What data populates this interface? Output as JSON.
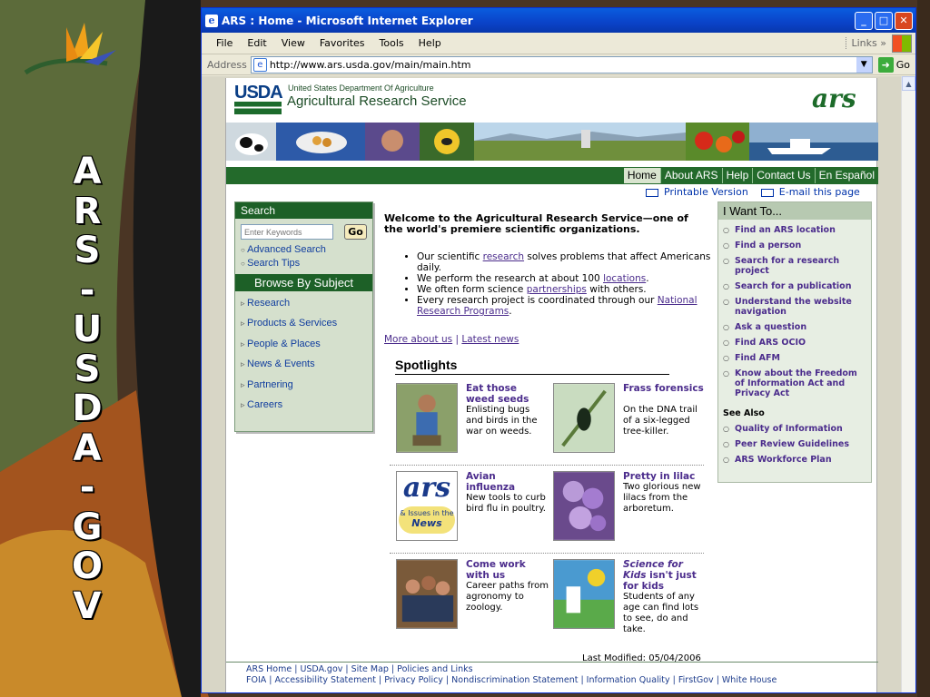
{
  "slide": {
    "vertical_title_chars": [
      "A",
      "R",
      "S",
      "-",
      "U",
      "S",
      "D",
      "A",
      "-",
      "G",
      "O",
      "V"
    ]
  },
  "window": {
    "title": "ARS : Home - Microsoft Internet Explorer",
    "menu": [
      "File",
      "Edit",
      "View",
      "Favorites",
      "Tools",
      "Help"
    ],
    "links_label": "Links",
    "address_label": "Address",
    "url": "http://www.ars.usda.gov/main/main.htm",
    "go_label": "Go"
  },
  "header": {
    "usda": "USDA",
    "dept": "United States Department Of Agriculture",
    "agency": "Agricultural Research Service",
    "ars_logo": "ars"
  },
  "nav": [
    "Home",
    "About ARS",
    "Help",
    "Contact Us",
    "En Español"
  ],
  "util": {
    "printable": "Printable Version",
    "email": "E-mail this page"
  },
  "search": {
    "title": "Search",
    "placeholder": "Enter Keywords",
    "go": "Go",
    "links": [
      "Advanced Search",
      "Search Tips"
    ],
    "browse_title": "Browse By Subject",
    "subjects": [
      "Research",
      "Products & Services",
      "People & Places",
      "News & Events",
      "Partnering",
      "Careers"
    ]
  },
  "main": {
    "welcome": "Welcome to the Agricultural Research Service—one of the world's premiere scientific organizations.",
    "bullets": [
      {
        "pre": "Our scientific ",
        "link": "research",
        "post": " solves problems that affect Americans daily."
      },
      {
        "pre": "We perform the research at about 100 ",
        "link": "locations",
        "post": "."
      },
      {
        "pre": "We often form science ",
        "link": "partnerships",
        "post": " with others."
      },
      {
        "pre": "Every research project is coordinated through our ",
        "link": "National Research Programs",
        "post": "."
      }
    ],
    "more_about": "More about us",
    "sep": "|",
    "latest_news": "Latest news",
    "spotlights_title": "Spotlights",
    "spotlights": [
      {
        "title": "Eat those weed seeds",
        "desc": "Enlisting bugs and birds in the war on weeds."
      },
      {
        "title": "Frass forensics",
        "desc": "On the DNA trail of a six-legged tree-killer."
      },
      {
        "title": "Avian influenza",
        "desc": "New tools to curb bird flu in poultry."
      },
      {
        "title": "Pretty in lilac",
        "desc": "Two glorious new lilacs from the arboretum."
      },
      {
        "title": "Come work with us",
        "desc": "Career paths from agronomy to zoology."
      },
      {
        "title_italic": "Science for Kids",
        "title_rest": " isn't just for kids",
        "desc": "Students of any age can find lots to see, do and take."
      }
    ],
    "news_logo_text": "& Issues in the",
    "news_logo_word": "News",
    "last_modified": "Last Modified: 05/04/2006"
  },
  "want": {
    "title": "I Want To...",
    "items": [
      "Find an ARS location",
      "Find a person",
      "Search for a research project",
      "Search for a publication",
      "Understand the website navigation",
      "Ask a question",
      "Find ARS OCIO",
      "Find AFM",
      "Know about the Freedom of Information Act and Privacy Act"
    ],
    "see_also_title": "See Also",
    "see_also": [
      "Quality of Information",
      "Peer Review Guidelines",
      "ARS Workforce Plan"
    ]
  },
  "footer": {
    "line1": "ARS Home | USDA.gov | Site Map | Policies and Links",
    "line2": "FOIA | Accessibility Statement | Privacy Policy | Nondiscrimination Statement | Information Quality | FirstGov | White House"
  }
}
